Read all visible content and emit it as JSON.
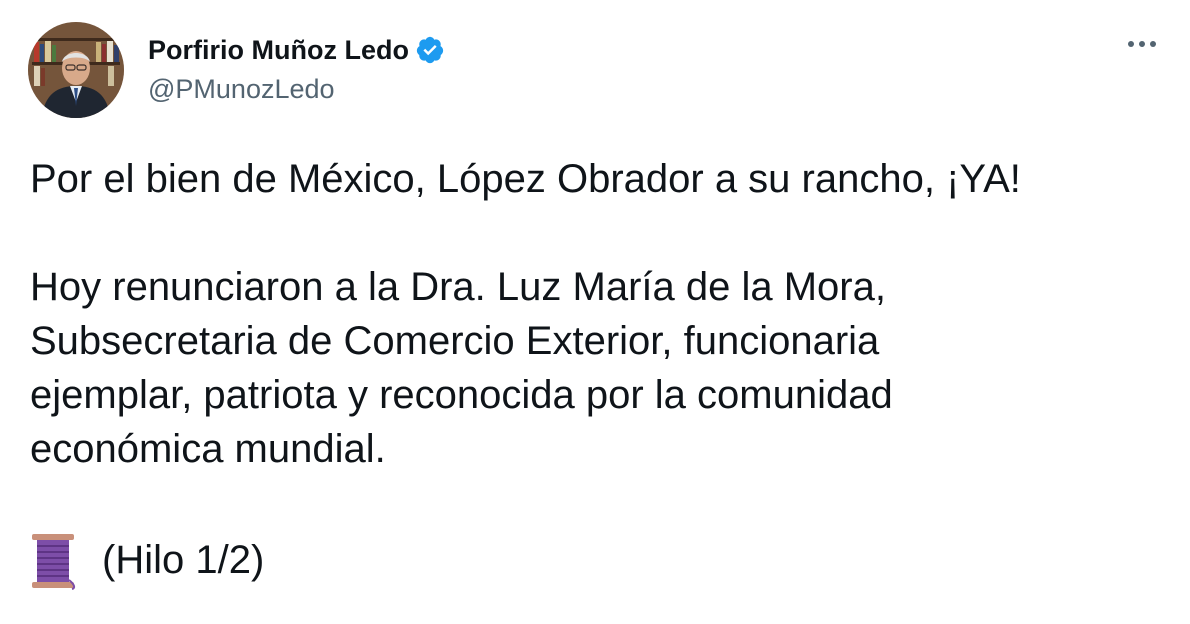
{
  "author": {
    "display_name": "Porfirio Muñoz Ledo",
    "handle": "@PMunozLedo",
    "verified_icon": "verified-badge-icon"
  },
  "tweet": {
    "paragraph_1": "Por el bien de México, López Obrador a su rancho, ¡YA!",
    "paragraph_2_line_1": "Hoy renunciaron a la Dra. Luz María de la Mora,",
    "paragraph_2_line_2": "Subsecretaria de Comercio Exterior, funcionaria",
    "paragraph_2_line_3": "ejemplar, patriota y reconocida por la comunidad",
    "paragraph_2_line_4": "económica mundial.",
    "thread_emoji": "thread-spool-icon",
    "thread_label": "(Hilo 1/2)"
  },
  "colors": {
    "text": "#0f1419",
    "secondary": "#536471",
    "verified": "#1d9bf0",
    "spool": "#7d4ea8"
  },
  "icons": {
    "more": "more-options-icon",
    "avatar": "avatar"
  }
}
